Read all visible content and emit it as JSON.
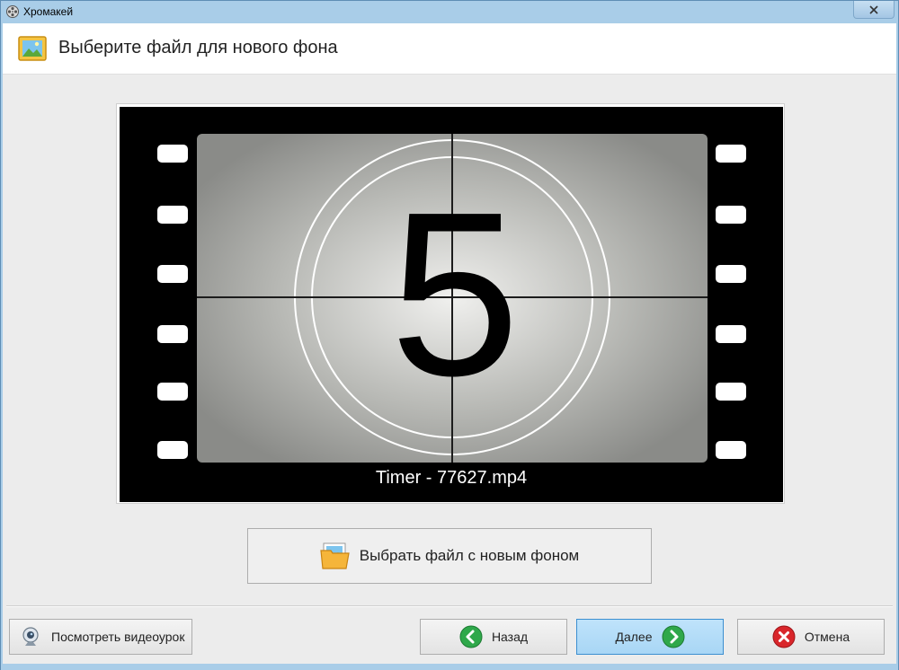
{
  "window": {
    "title": "Хромакей"
  },
  "header": {
    "title": "Выберите файл для нового фона",
    "icon": "picture-folder-icon"
  },
  "preview": {
    "filename": "Timer - 77627.mp4",
    "countdown_digit": "5"
  },
  "actions": {
    "choose_file_label": "Выбрать файл с новым фоном"
  },
  "footer": {
    "watch_tutorial_label": "Посмотреть видеоурок",
    "back_label": "Назад",
    "next_label": "Далее",
    "cancel_label": "Отмена"
  },
  "colors": {
    "title_bar": "#a9cde8",
    "primary_button": "#a8d6f5",
    "arrow_green": "#2fa84a",
    "cancel_red": "#d9262b",
    "film_black": "#000000"
  }
}
